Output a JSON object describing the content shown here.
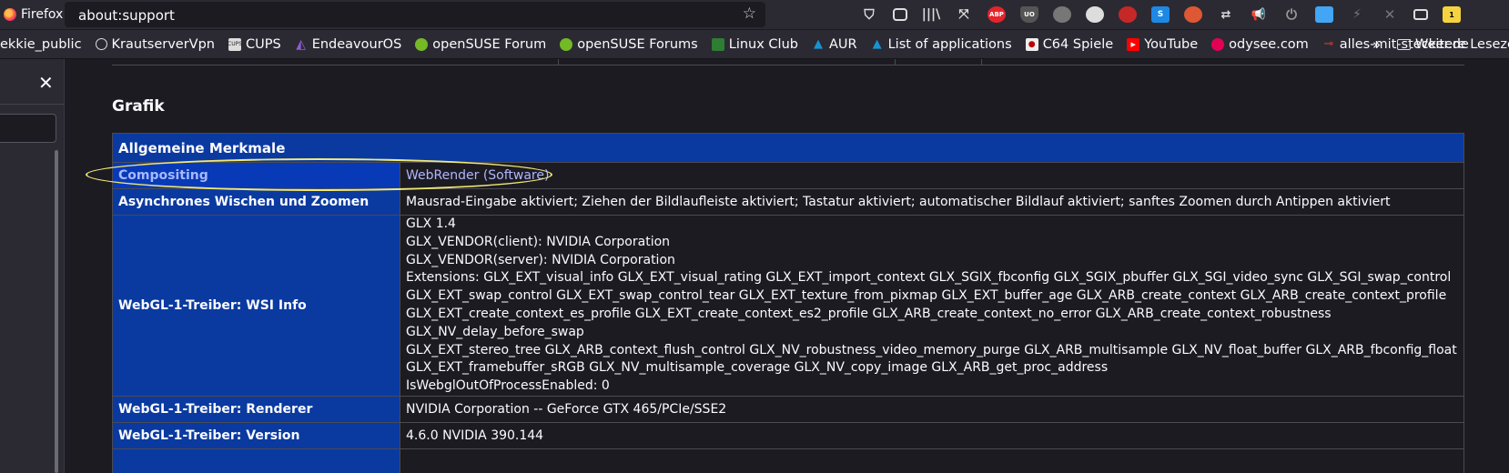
{
  "browser": {
    "name": "Firefox",
    "url": "about:support"
  },
  "bookmarks": {
    "items": [
      {
        "label": "ekkie_public",
        "icon": "none"
      },
      {
        "label": "KrautserverVpn",
        "icon": "globe-icon"
      },
      {
        "label": "CUPS",
        "icon": "cups-icon"
      },
      {
        "label": "EndeavourOS",
        "icon": "endeavouros-icon"
      },
      {
        "label": "openSUSE Forum",
        "icon": "opensuse-icon"
      },
      {
        "label": "openSUSE Forums",
        "icon": "opensuse-icon"
      },
      {
        "label": "Linux Club",
        "icon": "linux-club-icon"
      },
      {
        "label": "AUR",
        "icon": "arch-icon"
      },
      {
        "label": "List of applications",
        "icon": "arch-icon"
      },
      {
        "label": "C64 Spiele",
        "icon": "c64-icon"
      },
      {
        "label": "YouTube",
        "icon": "youtube-icon"
      },
      {
        "label": "odysee.com",
        "icon": "odysee-icon"
      },
      {
        "label": "alles-mit-stecker.de",
        "icon": "plug-icon"
      }
    ],
    "more": "»",
    "folder": "Weitere Lesezei"
  },
  "toolbar": {
    "adblock_label": "ABP",
    "ublock_label": "UO",
    "s_label": "S",
    "badge_label": "1"
  },
  "content": {
    "section_title": "Grafik",
    "table_caption": "Allgemeine Merkmale",
    "rows": [
      {
        "key": "Compositing",
        "lines": [
          "WebRender (Software)"
        ]
      },
      {
        "key": "Asynchrones Wischen und Zoomen",
        "lines": [
          "Mausrad-Eingabe aktiviert; Ziehen der Bildlaufleiste aktiviert; Tastatur aktiviert; automatischer Bildlauf aktiviert; sanftes Zoomen durch Antippen aktiviert"
        ]
      },
      {
        "key": "WebGL-1-Treiber: WSI Info",
        "lines": [
          "GLX 1.4",
          "GLX_VENDOR(client): NVIDIA Corporation",
          "GLX_VENDOR(server): NVIDIA Corporation",
          "Extensions: GLX_EXT_visual_info GLX_EXT_visual_rating GLX_EXT_import_context GLX_SGIX_fbconfig GLX_SGIX_pbuffer GLX_SGI_video_sync GLX_SGI_swap_control",
          "GLX_EXT_swap_control GLX_EXT_swap_control_tear GLX_EXT_texture_from_pixmap GLX_EXT_buffer_age GLX_ARB_create_context GLX_ARB_create_context_profile",
          "GLX_EXT_create_context_es_profile GLX_EXT_create_context_es2_profile GLX_ARB_create_context_no_error GLX_ARB_create_context_robustness GLX_NV_delay_before_swap",
          "GLX_EXT_stereo_tree GLX_ARB_context_flush_control GLX_NV_robustness_video_memory_purge GLX_ARB_multisample GLX_NV_float_buffer GLX_ARB_fbconfig_float",
          "GLX_EXT_framebuffer_sRGB GLX_NV_multisample_coverage GLX_NV_copy_image GLX_ARB_get_proc_address",
          "IsWebglOutOfProcessEnabled: 0"
        ]
      },
      {
        "key": "WebGL-1-Treiber: Renderer",
        "lines": [
          "NVIDIA Corporation -- GeForce GTX 465/PCIe/SSE2"
        ]
      },
      {
        "key": "WebGL-1-Treiber: Version",
        "lines": [
          "4.6.0 NVIDIA 390.144"
        ]
      }
    ]
  },
  "colors": {
    "key_cell_bg": "#0a3aa0",
    "highlight_ellipse": "#f1e978",
    "page_bg": "#1c1b22"
  }
}
